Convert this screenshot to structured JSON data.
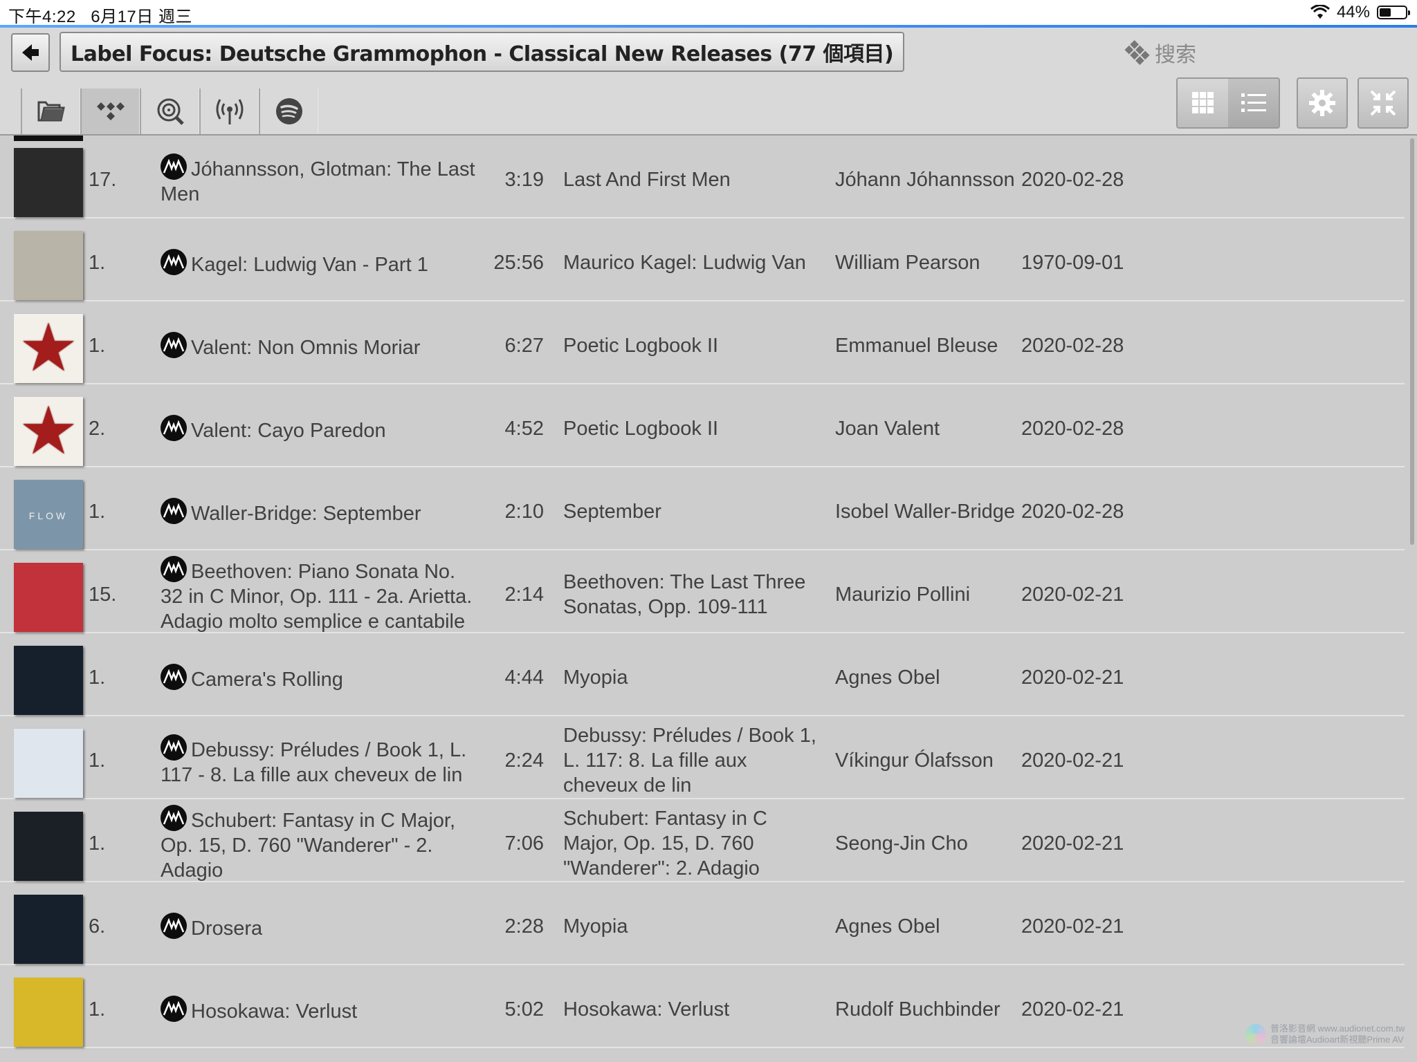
{
  "status_bar": {
    "time": "下午4:22",
    "date": "6月17日 週三",
    "battery": "44%",
    "battery_level": 0.44
  },
  "header": {
    "title": "Label Focus: Deutsche Grammophon - Classical New Releases (77 個項目)",
    "search_label": "搜索"
  },
  "tabs": [
    {
      "icon": "folder-icon"
    },
    {
      "icon": "tidal-icon"
    },
    {
      "icon": "disc-search-icon"
    },
    {
      "icon": "radio-icon"
    },
    {
      "icon": "spotify-icon"
    }
  ],
  "tracks": [
    {
      "index": "17.",
      "title": "Jóhannsson, Glotman: The Last Men",
      "duration": "3:19",
      "album": "Last And First Men",
      "artist": "Jóhann Jóhannsson",
      "date": "2020-02-28",
      "cover_color": "#2a2a2a"
    },
    {
      "index": "1.",
      "title": "Kagel: Ludwig Van - Part 1",
      "duration": "25:56",
      "album": "Maurico Kagel: Ludwig Van",
      "artist": "William Pearson",
      "date": "1970-09-01",
      "cover_color": "#b9b4a8"
    },
    {
      "index": "1.",
      "title": "Valent: Non Omnis Moriar",
      "duration": "6:27",
      "album": "Poetic Logbook II",
      "artist": "Emmanuel Bleuse",
      "date": "2020-02-28",
      "cover_color": "#f3f0ea"
    },
    {
      "index": "2.",
      "title": "Valent: Cayo Paredon",
      "duration": "4:52",
      "album": "Poetic Logbook II",
      "artist": "Joan Valent",
      "date": "2020-02-28",
      "cover_color": "#f3f0ea"
    },
    {
      "index": "1.",
      "title": "Waller-Bridge: September",
      "duration": "2:10",
      "album": "September",
      "artist": "Isobel Waller-Bridge",
      "date": "2020-02-28",
      "cover_color": "#7d95a8",
      "cover_text": "FLOW"
    },
    {
      "index": "15.",
      "title": "Beethoven: Piano Sonata No. 32 in C Minor, Op. 111 - 2a. Arietta. Adagio molto semplice e cantabile",
      "duration": "2:14",
      "album": "Beethoven: The Last Three Sonatas, Opp. 109-111",
      "artist": "Maurizio Pollini",
      "date": "2020-02-21",
      "cover_color": "#c2323a"
    },
    {
      "index": "1.",
      "title": "Camera's Rolling",
      "duration": "4:44",
      "album": "Myopia",
      "artist": "Agnes Obel",
      "date": "2020-02-21",
      "cover_color": "#15202c"
    },
    {
      "index": "1.",
      "title": "Debussy: Préludes / Book 1, L. 117 - 8. La fille aux cheveux de lin",
      "duration": "2:24",
      "album": "Debussy: Préludes / Book 1, L. 117: 8. La fille aux cheveux de lin",
      "artist": "Víkingur Ólafsson",
      "date": "2020-02-21",
      "cover_color": "#dfe6ee"
    },
    {
      "index": "1.",
      "title": "Schubert: Fantasy in C Major, Op. 15, D. 760 \"Wanderer\" - 2. Adagio",
      "duration": "7:06",
      "album": "Schubert: Fantasy in C Major, Op. 15, D. 760 \"Wanderer\": 2. Adagio",
      "artist": "Seong-Jin Cho",
      "date": "2020-02-21",
      "cover_color": "#1b1f26"
    },
    {
      "index": "6.",
      "title": "Drosera",
      "duration": "2:28",
      "album": "Myopia",
      "artist": "Agnes Obel",
      "date": "2020-02-21",
      "cover_color": "#15202c"
    },
    {
      "index": "1.",
      "title": "Hosokawa: Verlust",
      "duration": "5:02",
      "album": "Hosokawa: Verlust",
      "artist": "Rudolf Buchbinder",
      "date": "2020-02-21",
      "cover_color": "#d8b728"
    }
  ],
  "watermark": {
    "line1": "普洛影音網 www.audionet.com.tw",
    "line2": "音響論壇Audioart新視聽Prime AV"
  }
}
